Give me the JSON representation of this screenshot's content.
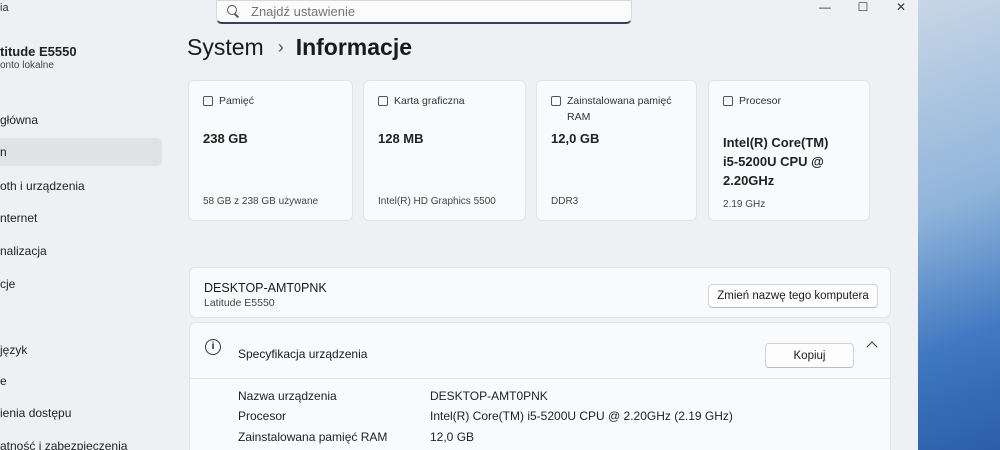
{
  "titlebar": {
    "app_title": "ia",
    "search_placeholder": "Znajdź ustawienie",
    "minimize": "—",
    "maximize": "☐",
    "close": "✕"
  },
  "sidebar": {
    "device_name": "titude E5550",
    "device_sub": "onto lokalne",
    "items": [
      {
        "label": "główna"
      },
      {
        "label": "n"
      },
      {
        "label": "oth i urządzenia"
      },
      {
        "label": "nternet"
      },
      {
        "label": "nalizacja"
      },
      {
        "label": "cje"
      },
      {
        "label": "język"
      },
      {
        "label": "e"
      },
      {
        "label": "ienia dostępu"
      },
      {
        "label": "atność i zabezpieczenia"
      }
    ]
  },
  "breadcrumb": {
    "parent": "System",
    "separator": "›",
    "current": "Informacje"
  },
  "cards": [
    {
      "title": "Pamięć",
      "icon": "storage-icon",
      "value": "238 GB",
      "detail": "58 GB z 238 GB używane"
    },
    {
      "title": "Karta graficzna",
      "icon": "gpu-icon",
      "value": "128 MB",
      "detail": "Intel(R) HD Graphics 5500"
    },
    {
      "title": "Zainstalowana pamięć RAM",
      "icon": "ram-icon",
      "value": "12,0 GB",
      "detail": "DDR3"
    },
    {
      "title": "Procesor",
      "icon": "cpu-icon",
      "value": "Intel(R) Core(TM) i5-5200U CPU @ 2.20GHz",
      "detail": "2.19 GHz"
    }
  ],
  "device_panel": {
    "name": "DESKTOP-AMT0PNK",
    "model": "Latitude E5550",
    "rename_label": "Zmień nazwę tego komputera"
  },
  "spec_panel": {
    "title": "Specyfikacja urządzenia",
    "copy_label": "Kopiuj",
    "rows": [
      {
        "key": "Nazwa urządzenia",
        "value": "DESKTOP-AMT0PNK"
      },
      {
        "key": "Procesor",
        "value": "Intel(R) Core(TM) i5-5200U CPU @ 2.20GHz (2.19 GHz)"
      },
      {
        "key": "Zainstalowana pamięć RAM",
        "value": "12,0 GB"
      }
    ]
  }
}
